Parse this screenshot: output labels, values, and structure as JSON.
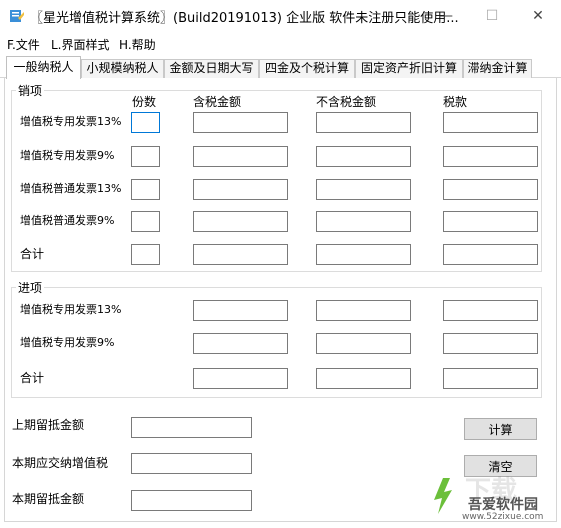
{
  "window": {
    "title": "〖星光增值税计算系统〗(Build20191013) 企业版 软件未注册只能使用...",
    "minimize_glyph": "—",
    "maximize_glyph": "☐",
    "close_glyph": "✕"
  },
  "menu": [
    "F.文件",
    "L.界面样式",
    "H.帮助"
  ],
  "tabs": [
    "一般纳税人",
    "小规模纳税人",
    "金额及日期大写",
    "四金及个税计算",
    "固定资产折旧计算",
    "滞纳金计算"
  ],
  "sales": {
    "title": "销项",
    "columns": [
      "份数",
      "含税金额",
      "不含税金额",
      "税款"
    ],
    "rows": [
      "增值税专用发票13%",
      "增值税专用发票9%",
      "增值税普通发票13%",
      "增值税普通发票9%",
      "合计"
    ]
  },
  "purchase": {
    "title": "进项",
    "rows": [
      "增值税专用发票13%",
      "增值税专用发票9%",
      "合计"
    ]
  },
  "summary": [
    "上期留抵金额",
    "本期应交纳增值税",
    "本期留抵金额"
  ],
  "buttons": {
    "calc": "计算",
    "clear": "清空"
  },
  "watermark": {
    "brand": "吾爱软件园",
    "url": "www.52zixue.com",
    "big": "下载"
  }
}
